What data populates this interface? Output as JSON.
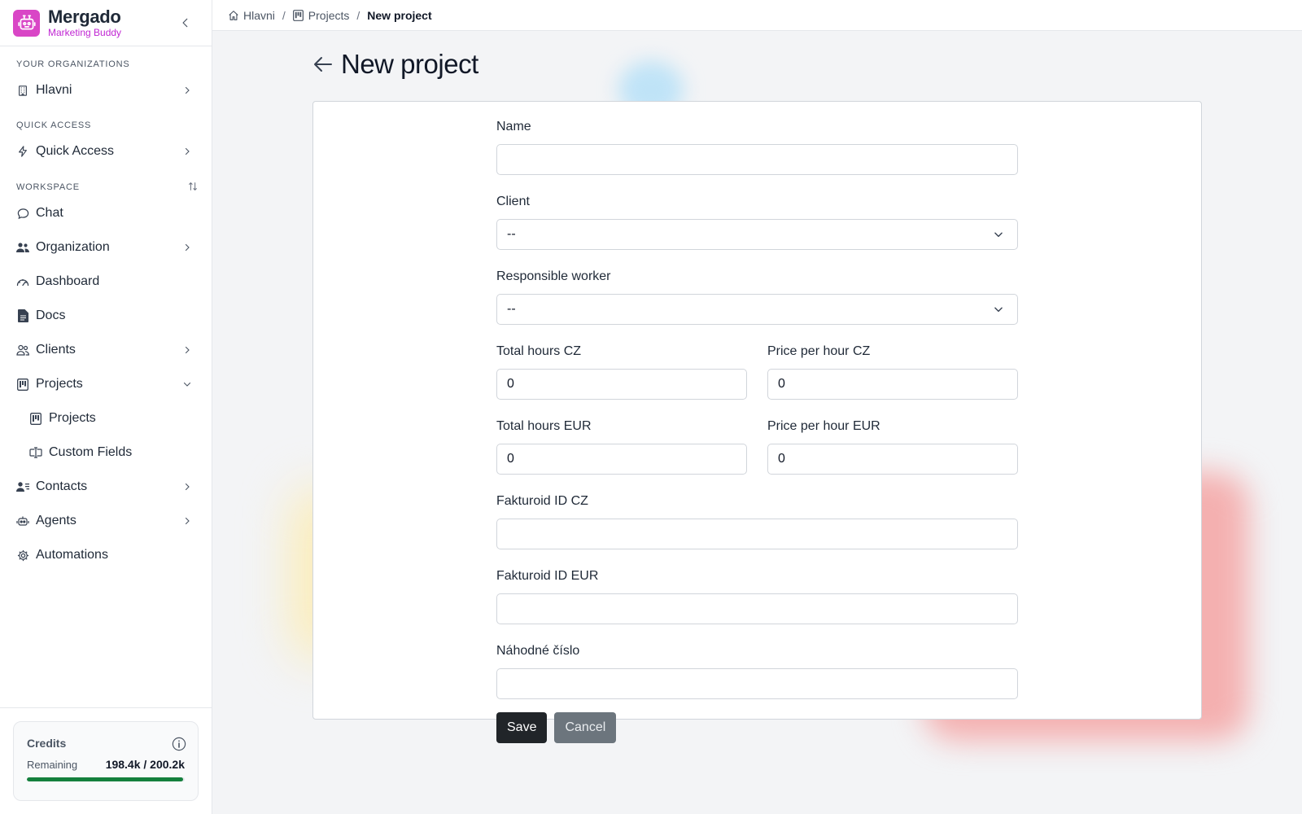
{
  "brand": {
    "name": "Mergado",
    "subtitle": "Marketing Buddy"
  },
  "sidebar": {
    "sections": {
      "organizations": "YOUR ORGANIZATIONS",
      "quick_access": "QUICK ACCESS",
      "workspace": "WORKSPACE"
    },
    "org_item": "Hlavni",
    "quick_item": "Quick Access",
    "items": {
      "chat": "Chat",
      "organization": "Organization",
      "dashboard": "Dashboard",
      "docs": "Docs",
      "clients": "Clients",
      "projects": "Projects",
      "projects_sub": "Projects",
      "custom_fields": "Custom Fields",
      "contacts": "Contacts",
      "agents": "Agents",
      "automations": "Automations"
    }
  },
  "credits": {
    "title": "Credits",
    "remaining_label": "Remaining",
    "value": "198.4k / 200.2k",
    "fraction": 0.991
  },
  "breadcrumb": {
    "home": "Hlavni",
    "projects": "Projects",
    "current": "New project",
    "separator": "/"
  },
  "page": {
    "title": "New project"
  },
  "form": {
    "name": {
      "label": "Name",
      "value": ""
    },
    "client": {
      "label": "Client",
      "value": "--"
    },
    "worker": {
      "label": "Responsible worker",
      "value": "--"
    },
    "total_hours_cz": {
      "label": "Total hours CZ",
      "value": "0"
    },
    "price_hour_cz": {
      "label": "Price per hour CZ",
      "value": "0"
    },
    "total_hours_eur": {
      "label": "Total hours EUR",
      "value": "0"
    },
    "price_hour_eur": {
      "label": "Price per hour EUR",
      "value": "0"
    },
    "fakturoid_cz": {
      "label": "Fakturoid ID CZ",
      "value": ""
    },
    "fakturoid_eur": {
      "label": "Fakturoid ID EUR",
      "value": ""
    },
    "nahodne": {
      "label": "Náhodné číslo",
      "value": ""
    },
    "save": "Save",
    "cancel": "Cancel"
  },
  "colors": {
    "brand": "#d946c6",
    "accent_sub": "#c026d3",
    "progress": "#15803d",
    "save_btn": "#212529",
    "cancel_btn": "#6c757d"
  }
}
